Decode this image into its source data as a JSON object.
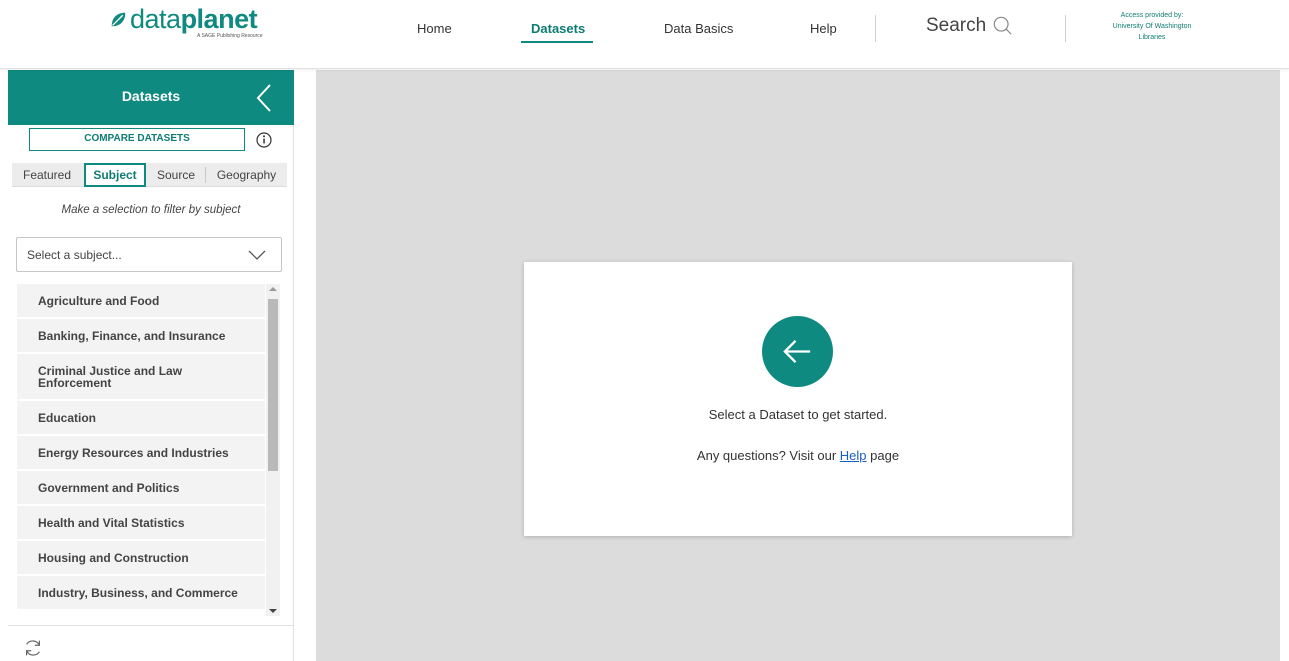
{
  "brand": {
    "name_light": "data",
    "name_bold": "planet",
    "sub": "A SAGE Publishing Resource",
    "color": "#0f8a80"
  },
  "nav": {
    "home": "Home",
    "datasets": "Datasets",
    "data_basics": "Data Basics",
    "help": "Help",
    "active": "Datasets"
  },
  "search": {
    "label": "Search",
    "icon": "search-icon"
  },
  "access": {
    "line1": "Access provided by:",
    "line2": "University Of Washington",
    "line3": "Libraries"
  },
  "sidebar": {
    "title": "Datasets",
    "collapse_icon": "chevron-left-icon",
    "compare_label": "COMPARE DATASETS",
    "info_icon": "info-icon",
    "tabs": [
      {
        "label": "Featured",
        "active": false
      },
      {
        "label": "Subject",
        "active": true
      },
      {
        "label": "Source",
        "active": false
      },
      {
        "label": "Geography",
        "active": false
      }
    ],
    "filter_hint": "Make a selection to filter by subject",
    "select_placeholder": "Select a subject...",
    "subjects": [
      "Agriculture and Food",
      "Banking, Finance, and Insurance",
      "Criminal Justice and Law Enforcement",
      "Education",
      "Energy Resources and Industries",
      "Government and Politics",
      "Health and Vital Statistics",
      "Housing and Construction",
      "Industry, Business, and Commerce"
    ],
    "refresh_icon": "refresh-icon"
  },
  "main": {
    "prompt": "Select a Dataset to get started.",
    "question_prefix": "Any questions? Visit our",
    "help_link": "Help",
    "question_suffix": "page",
    "arrow_icon": "arrow-left-icon"
  }
}
